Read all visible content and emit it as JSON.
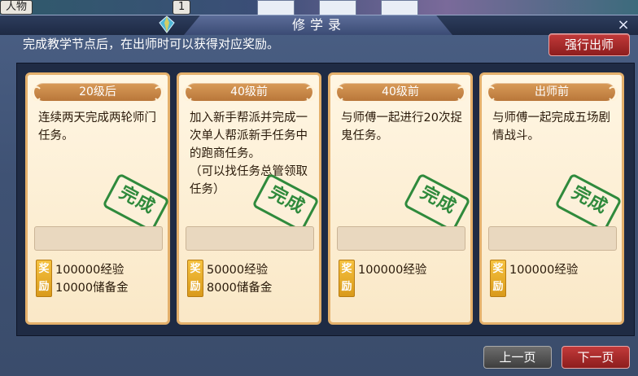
{
  "background": {
    "tag_left": "人物",
    "tag_number": "1"
  },
  "dialog": {
    "title": "修学录",
    "close_label": "×",
    "instructions": "完成教学节点后，在出师时可以获得对应奖励。",
    "force_graduate_label": "强行出师",
    "prev_label": "上一页",
    "next_label": "下一页"
  },
  "cards": [
    {
      "header": "20级后",
      "description": "连续两天完成两轮师门任务。",
      "stamp": "完成",
      "reward_badge_top": "奖",
      "reward_badge_bottom": "励",
      "rewards": [
        "100000经验",
        "10000储备金"
      ]
    },
    {
      "header": "40级前",
      "description": "加入新手帮派并完成一次单人帮派新手任务中的跑商任务。\n（可以找任务总管领取任务）",
      "stamp": "完成",
      "reward_badge_top": "奖",
      "reward_badge_bottom": "励",
      "rewards": [
        "50000经验",
        "8000储备金"
      ]
    },
    {
      "header": "40级前",
      "description": "与师傅一起进行20次捉鬼任务。",
      "stamp": "完成",
      "reward_badge_top": "奖",
      "reward_badge_bottom": "励",
      "rewards": [
        "100000经验"
      ]
    },
    {
      "header": "出师前",
      "description": "与师傅一起完成五场剧情战斗。",
      "stamp": "完成",
      "reward_badge_top": "奖",
      "reward_badge_bottom": "励",
      "rewards": [
        "100000经验"
      ]
    }
  ],
  "colors": {
    "accent_red": "#b52c2c",
    "stamp_green": "#2f8a3c",
    "card_border": "#e4b06b"
  }
}
